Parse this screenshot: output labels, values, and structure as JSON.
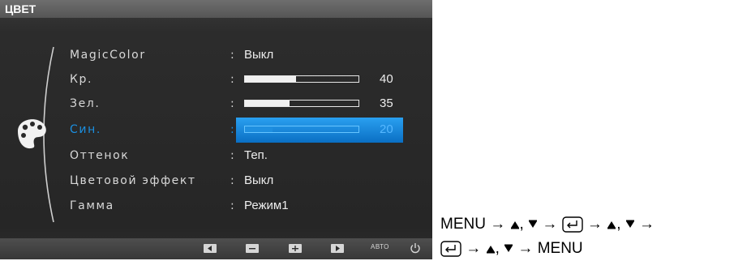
{
  "osd": {
    "title": "ЦВЕТ",
    "category_icon": "palette-icon",
    "items": [
      {
        "label": "MagicColor",
        "value": "Выкл"
      },
      {
        "label": "Кр.",
        "level": 40,
        "number": "40"
      },
      {
        "label": "Зел.",
        "level": 35,
        "number": "35"
      },
      {
        "label": "Син.",
        "level": 20,
        "number": "20",
        "selected": true
      },
      {
        "label": "Оттенок",
        "value": "Теп."
      },
      {
        "label": "Цветовой эффект",
        "value": "Выкл"
      },
      {
        "label": "Гамма",
        "value": "Режим1"
      }
    ],
    "footer": {
      "buttons": [
        "left-arrow-icon",
        "minus-icon",
        "plus-icon",
        "right-arrow-icon"
      ],
      "auto_label": "АВТО",
      "power_icon": "power-icon"
    }
  },
  "instructions": {
    "line1": {
      "menu": "MENU"
    },
    "line2": {
      "menu": "MENU"
    }
  },
  "colors": {
    "selection": "#1b8fe0",
    "osd_background": "#2a2a2a",
    "title_bar": "#606060"
  }
}
